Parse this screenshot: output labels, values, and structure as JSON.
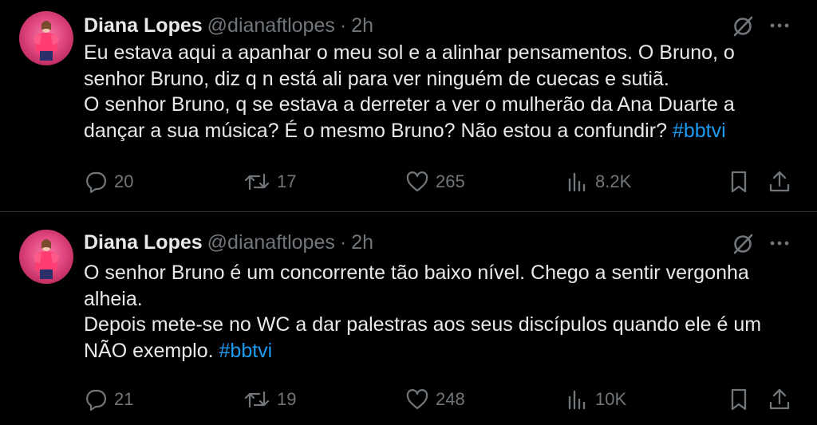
{
  "tweets": [
    {
      "author": {
        "name": "Diana Lopes",
        "handle": "@dianaftlopes"
      },
      "separator": "·",
      "time": "2h",
      "lines": [
        "Eu estava aqui a apanhar o meu sol e a alinhar pensamentos. O Bruno, o senhor Bruno, diz q n está ali para ver ninguém de cuecas e sutiã.",
        "O senhor Bruno, q se estava a derreter a ver o mulherão da Ana Duarte a dançar a sua música? É o mesmo Bruno? Não estou a confundir?"
      ],
      "hashtag": "#bbtvi",
      "stats": {
        "replies": "20",
        "reposts": "17",
        "likes": "265",
        "views": "8.2K"
      }
    },
    {
      "author": {
        "name": "Diana Lopes",
        "handle": "@dianaftlopes"
      },
      "separator": "·",
      "time": "2h",
      "lines": [
        "O senhor Bruno é um concorrente tão baixo nível. Chego a sentir vergonha alheia.",
        "Depois mete-se no WC a dar palestras aos seus discípulos quando ele é um NÃO exemplo."
      ],
      "hashtag": "#bbtvi",
      "stats": {
        "replies": "21",
        "reposts": "19",
        "likes": "248",
        "views": "10K"
      }
    }
  ],
  "icons": {
    "avatar": "profile-photo",
    "grok": "slashed-circle-icon",
    "more": "more-dots-icon",
    "reply": "speech-bubble-icon",
    "repost": "repost-arrows-icon",
    "like": "heart-icon",
    "views": "bar-chart-icon",
    "bookmark": "bookmark-icon",
    "share": "share-upload-icon"
  },
  "colors": {
    "background": "#000000",
    "text": "#e7e9ea",
    "muted": "#71767b",
    "hashtag": "#1d9bf0",
    "divider": "#2f3336"
  }
}
